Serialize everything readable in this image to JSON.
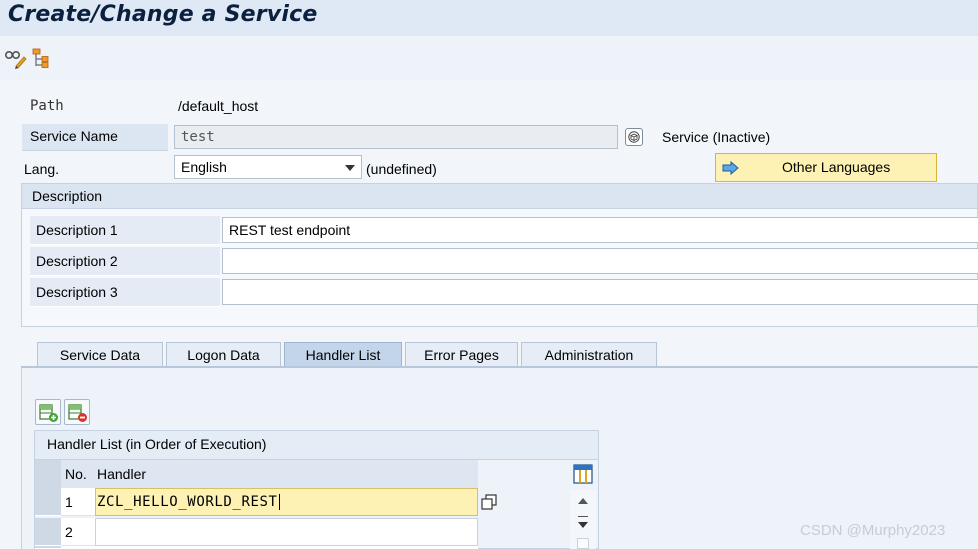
{
  "title": "Create/Change a Service",
  "toolbar": {
    "icons": [
      "display-change-icon",
      "hierarchy-icon"
    ]
  },
  "header": {
    "path_label": "Path",
    "path_value": "/default_host",
    "service_name_label": "Service Name",
    "service_name_value": "test",
    "service_status": "Service (Inactive)",
    "lang_label": "Lang.",
    "lang_value": "English",
    "lang_hint": "(undefined)",
    "other_languages_label": "Other Languages"
  },
  "description": {
    "group_title": "Description",
    "rows": [
      {
        "label": "Description 1",
        "value": "REST test endpoint"
      },
      {
        "label": "Description 2",
        "value": ""
      },
      {
        "label": "Description 3",
        "value": ""
      }
    ]
  },
  "tabs": [
    {
      "label": "Service Data",
      "active": false
    },
    {
      "label": "Logon Data",
      "active": false
    },
    {
      "label": "Handler List",
      "active": true
    },
    {
      "label": "Error Pages",
      "active": false
    },
    {
      "label": "Administration",
      "active": false
    }
  ],
  "handler_table": {
    "title": "Handler List (in Order of Execution)",
    "columns": [
      "No.",
      "Handler"
    ],
    "rows": [
      {
        "no": "1",
        "handler": "ZCL_HELLO_WORLD_REST"
      },
      {
        "no": "2",
        "handler": ""
      }
    ]
  },
  "watermark": "CSDN @Murphy2023",
  "colors": {
    "title_bar": "#dfe9f5",
    "button_highlight": "#fdf2b3",
    "selected_cell": "#fdf2b3",
    "active_tab": "#c3d5ea"
  }
}
